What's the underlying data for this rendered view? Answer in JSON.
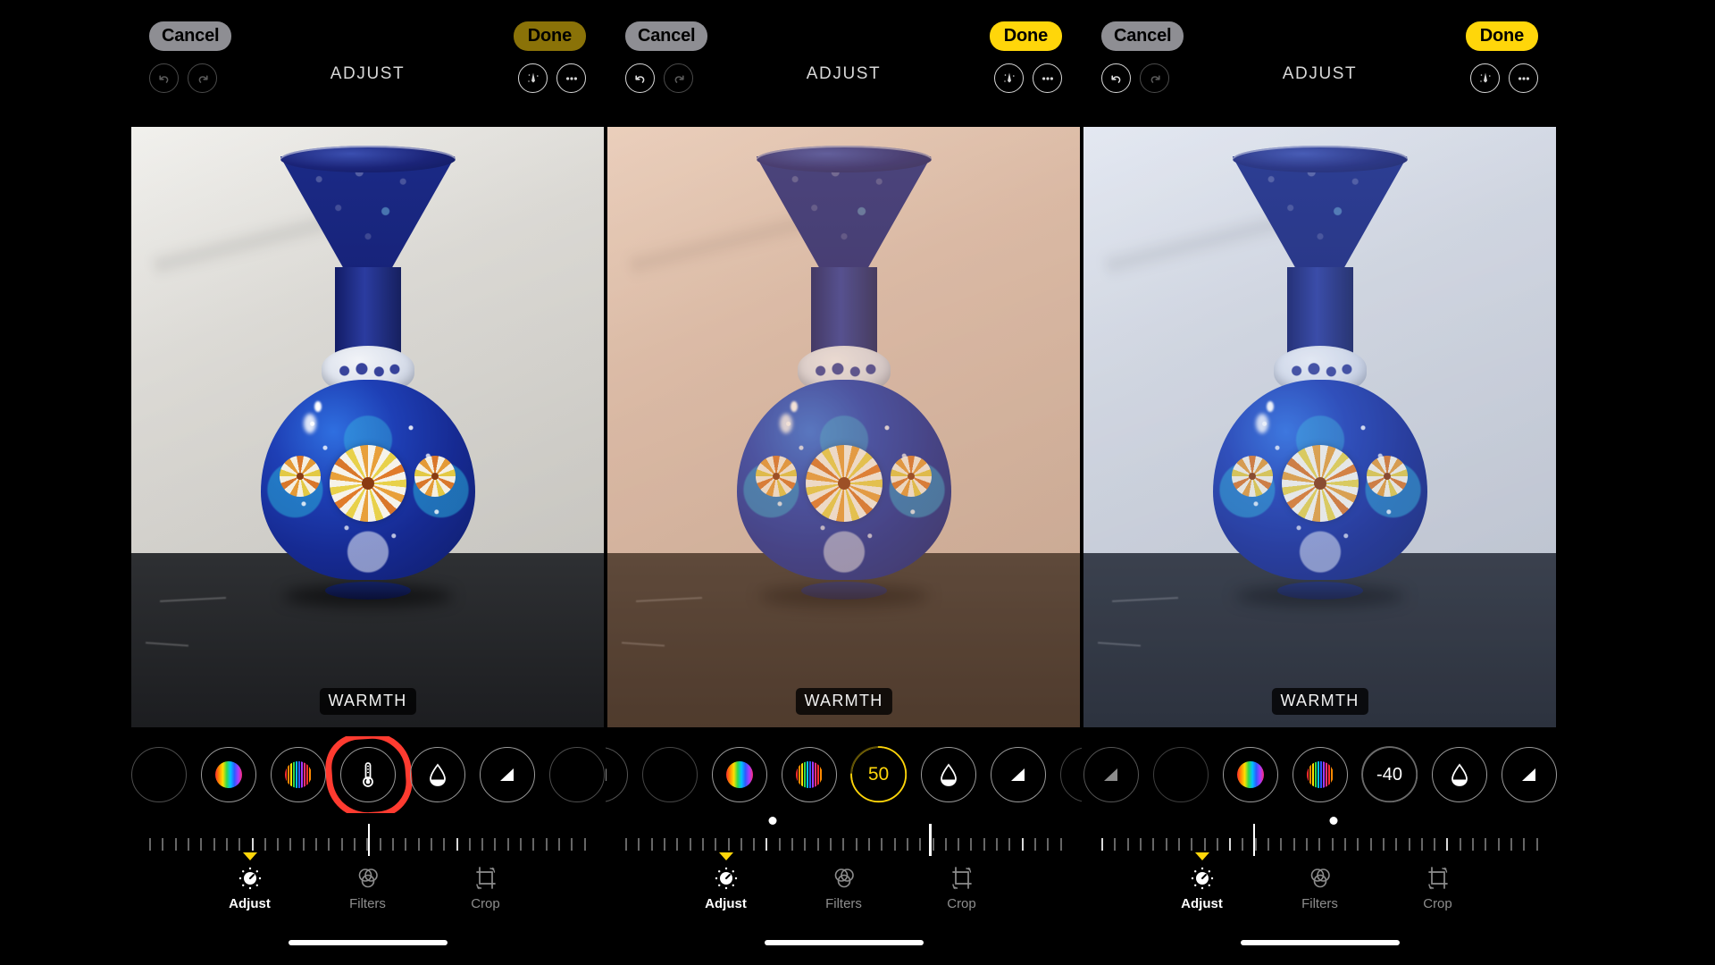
{
  "app": {
    "title": "ADJUST",
    "screen_count": 3
  },
  "panels": [
    {
      "id": "panel-1",
      "cancel_label": "Cancel",
      "done_label": "Done",
      "done_state": "dimmed",
      "title": "ADJUST",
      "undo_enabled": false,
      "redo_enabled": false,
      "overlay_label": "WARMTH",
      "grade": "neutral",
      "selected_tool": "warmth",
      "selected_value": "",
      "value_visible": false,
      "highlight_annotation": "red-circle-around-warmth-tool",
      "ruler": {
        "indicator_pct": 50,
        "dot_pct": null
      },
      "tools": [
        "saturation",
        "vibrance",
        "warmth",
        "tint",
        "sharpness"
      ]
    },
    {
      "id": "panel-2",
      "cancel_label": "Cancel",
      "done_label": "Done",
      "done_state": "active",
      "title": "ADJUST",
      "undo_enabled": true,
      "redo_enabled": false,
      "overlay_label": "WARMTH",
      "grade": "warm",
      "selected_tool": "warmth",
      "selected_value": "50",
      "value_visible": true,
      "value_color": "#ffd60a",
      "highlight_annotation": "",
      "ruler": {
        "indicator_pct": 68,
        "dot_pct": 35
      },
      "tools": [
        "sharpness-edge",
        "saturation",
        "vibrance",
        "warmth",
        "tint",
        "sharpness"
      ]
    },
    {
      "id": "panel-3",
      "cancel_label": "Cancel",
      "done_label": "Done",
      "done_state": "active",
      "title": "ADJUST",
      "undo_enabled": true,
      "redo_enabled": false,
      "overlay_label": "WARMTH",
      "grade": "cool",
      "selected_tool": "warmth",
      "selected_value": "-40",
      "value_visible": true,
      "value_color": "#ffffff",
      "highlight_annotation": "",
      "ruler": {
        "indicator_pct": 36,
        "dot_pct": 53
      },
      "tools": [
        "tint-edge",
        "sharpness-edge",
        "saturation",
        "vibrance",
        "warmth",
        "tint",
        "sharpness"
      ]
    }
  ],
  "icons": {
    "undo": "undo-icon",
    "redo": "redo-icon",
    "auto_enhance": "magic-wand-icon",
    "more": "ellipsis-icon",
    "saturation": "saturation-icon",
    "vibrance": "vibrance-icon",
    "warmth": "thermometer-icon",
    "tint": "water-drop-icon",
    "sharpness": "sharpness-triangle-icon"
  },
  "tabbar": {
    "tabs": [
      {
        "label": "Adjust",
        "icon": "adjust-dial-icon",
        "active": true
      },
      {
        "label": "Filters",
        "icon": "filters-circles-icon",
        "active": false
      },
      {
        "label": "Crop",
        "icon": "crop-icon",
        "active": false
      }
    ]
  },
  "colors": {
    "accent_yellow": "#ffd60a",
    "dimmed_yellow": "#8a7208",
    "cancel_gray": "#8e8e93",
    "annotation_red": "#ff3b30",
    "background": "#000000"
  }
}
